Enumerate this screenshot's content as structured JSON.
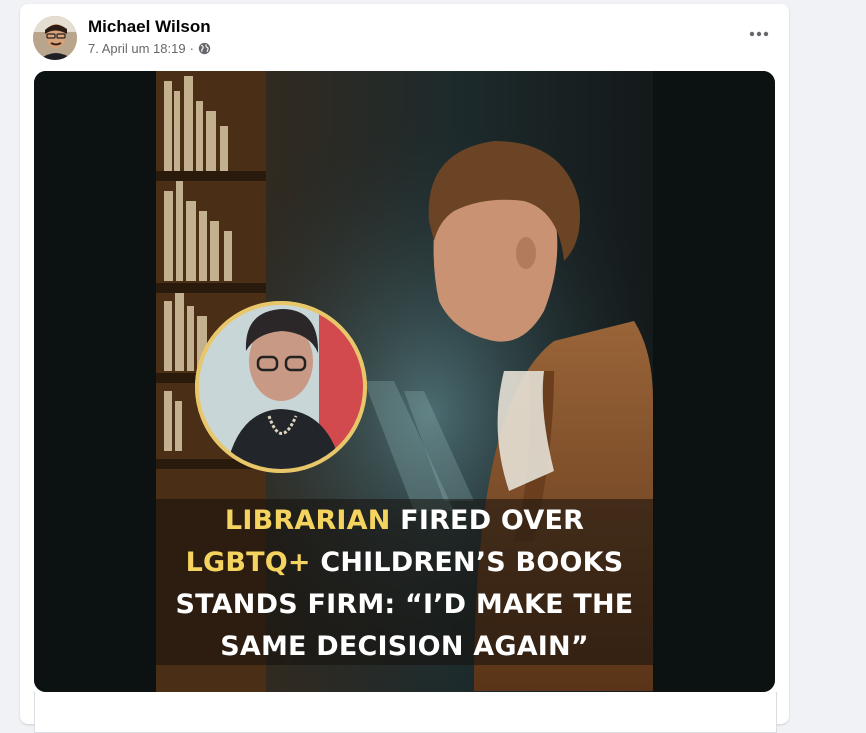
{
  "post": {
    "author": "Michael Wilson",
    "timestamp": "7. April um 18:19",
    "separator": "·",
    "privacy_icon": "globe-icon",
    "more_icon": "more-options-icon"
  },
  "image": {
    "headline": {
      "line1": {
        "highlight": "LIBRARIAN",
        "rest": " FIRED OVER"
      },
      "line2": {
        "highlight": "LGBTQ+",
        "rest": " CHILDREN’S BOOKS"
      },
      "line3": "STANDS FIRM: “I’D MAKE THE",
      "line4": "SAME DECISION AGAIN”"
    },
    "colors": {
      "highlight": "#f4d35e",
      "text": "#ffffff",
      "inset_ring": "#e8c66a"
    }
  }
}
